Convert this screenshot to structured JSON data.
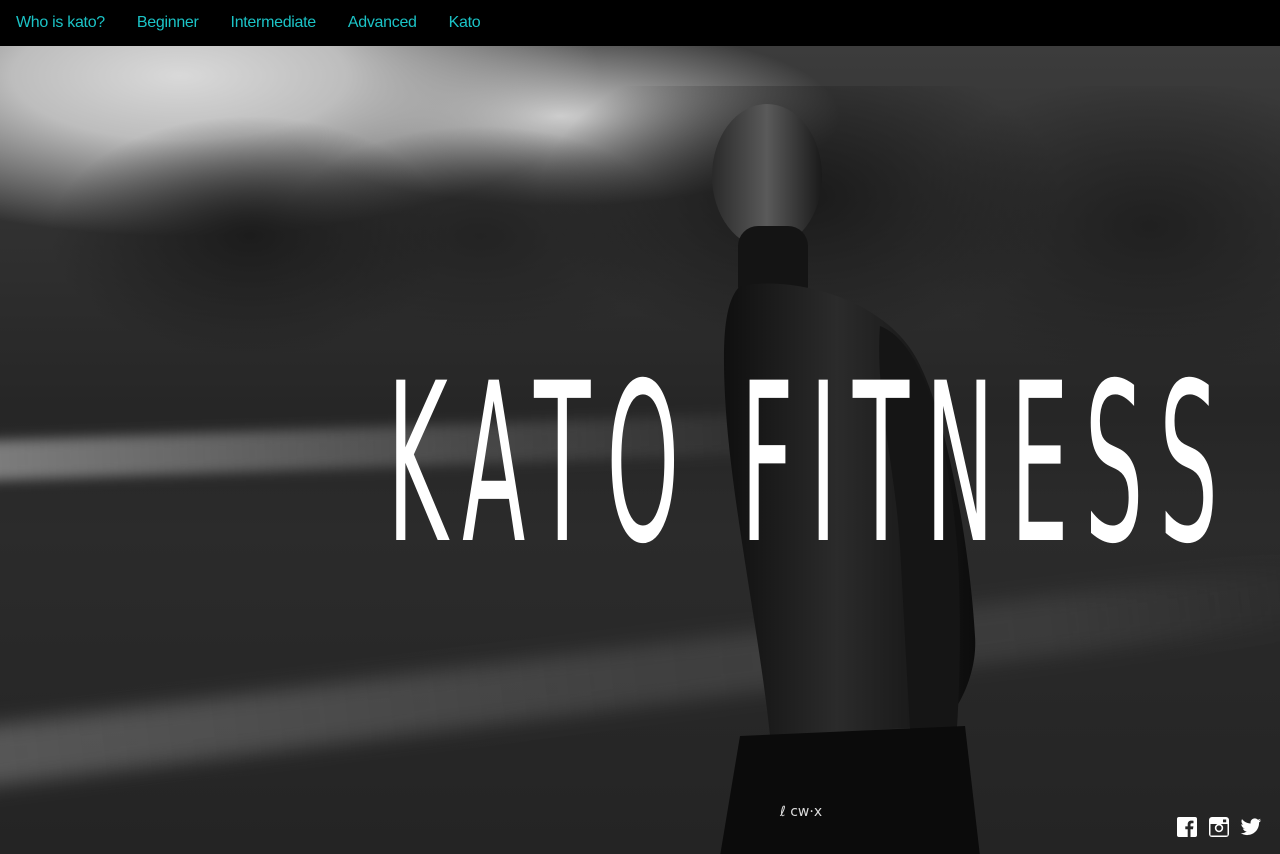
{
  "nav": {
    "items": [
      {
        "label": "Who is kato?"
      },
      {
        "label": "Beginner"
      },
      {
        "label": "Intermediate"
      },
      {
        "label": "Advanced"
      },
      {
        "label": "Kato"
      }
    ]
  },
  "hero": {
    "title": "KATO FITNESS"
  },
  "social": {
    "icons": [
      "facebook-icon",
      "instagram-icon",
      "twitter-icon"
    ]
  },
  "colors": {
    "nav_bg": "#000000",
    "nav_link": "#1bc3c6",
    "title": "#ffffff",
    "icon": "#ffffff"
  }
}
